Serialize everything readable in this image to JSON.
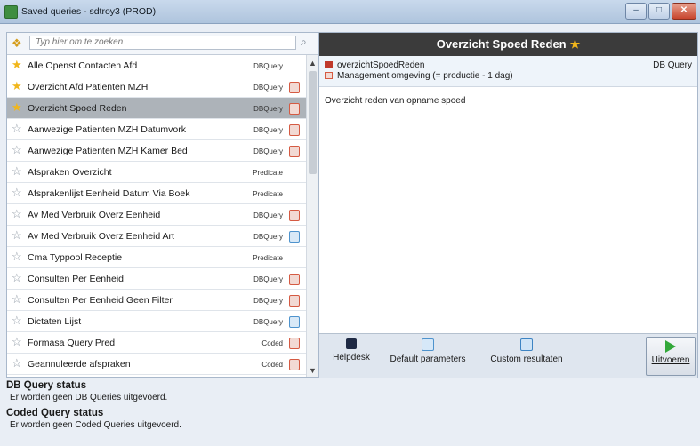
{
  "window": {
    "title": "Saved queries - sdtroy3 (PROD)",
    "minimize": "–",
    "maximize": "□",
    "close": "✕"
  },
  "search": {
    "placeholder": "Typ hier om te zoeken",
    "lead_icon": "queries-icon",
    "icon": "search-icon"
  },
  "queries": [
    {
      "name": "Alle Openst Contacten Afd",
      "type": "DBQuery",
      "fav": true,
      "selected": false,
      "indicator": "none"
    },
    {
      "name": "Overzicht Afd Patienten MZH",
      "type": "DBQuery",
      "fav": true,
      "selected": false,
      "indicator": "red"
    },
    {
      "name": "Overzicht Spoed Reden",
      "type": "DBQuery",
      "fav": true,
      "selected": true,
      "indicator": "red"
    },
    {
      "name": "Aanwezige Patienten MZH Datumvork",
      "type": "DBQuery",
      "fav": false,
      "selected": false,
      "indicator": "red"
    },
    {
      "name": "Aanwezige Patienten MZH Kamer Bed",
      "type": "DBQuery",
      "fav": false,
      "selected": false,
      "indicator": "red"
    },
    {
      "name": "Afspraken Overzicht",
      "type": "Predicate",
      "fav": false,
      "selected": false,
      "indicator": "none"
    },
    {
      "name": "Afsprakenlijst Eenheid Datum Via Boek",
      "type": "Predicate",
      "fav": false,
      "selected": false,
      "indicator": "none"
    },
    {
      "name": "Av Med Verbruik Overz Eenheid",
      "type": "DBQuery",
      "fav": false,
      "selected": false,
      "indicator": "red"
    },
    {
      "name": "Av Med Verbruik Overz Eenheid Art",
      "type": "DBQuery",
      "fav": false,
      "selected": false,
      "indicator": "blue"
    },
    {
      "name": "Cma Typpool Receptie",
      "type": "Predicate",
      "fav": false,
      "selected": false,
      "indicator": "none"
    },
    {
      "name": "Consulten Per Eenheid",
      "type": "DBQuery",
      "fav": false,
      "selected": false,
      "indicator": "red"
    },
    {
      "name": "Consulten Per Eenheid Geen Filter",
      "type": "DBQuery",
      "fav": false,
      "selected": false,
      "indicator": "red"
    },
    {
      "name": "Dictaten Lijst",
      "type": "DBQuery",
      "fav": false,
      "selected": false,
      "indicator": "blue"
    },
    {
      "name": "Formasa Query Pred",
      "type": "Coded",
      "fav": false,
      "selected": false,
      "indicator": "red"
    },
    {
      "name": "Geannuleerde afspraken",
      "type": "Coded",
      "fav": false,
      "selected": false,
      "indicator": "red"
    }
  ],
  "scroll": {
    "up": "▲",
    "down": "▼"
  },
  "detail": {
    "title": "Overzicht Spoed Reden",
    "query_id": "overzichtSpoedReden",
    "environment": "Management omgeving (= productie - 1 dag)",
    "query_type": "DB Query",
    "description": "Overzicht reden van opname spoed"
  },
  "toolbar": {
    "helpdesk": "Helpdesk",
    "default_parameters": "Default parameters",
    "custom_results": "Custom resultaten",
    "run": "Uitvoeren"
  },
  "status": {
    "db_title": "DB Query status",
    "db_text": "Er worden geen DB Queries uitgevoerd.",
    "coded_title": "Coded Query status",
    "coded_text": "Er worden geen Coded Queries uitgevoerd."
  },
  "colors": {
    "accent_star": "#f1b61b",
    "header_bg": "#3b3b3b",
    "selected_row": "#adb3b9"
  }
}
